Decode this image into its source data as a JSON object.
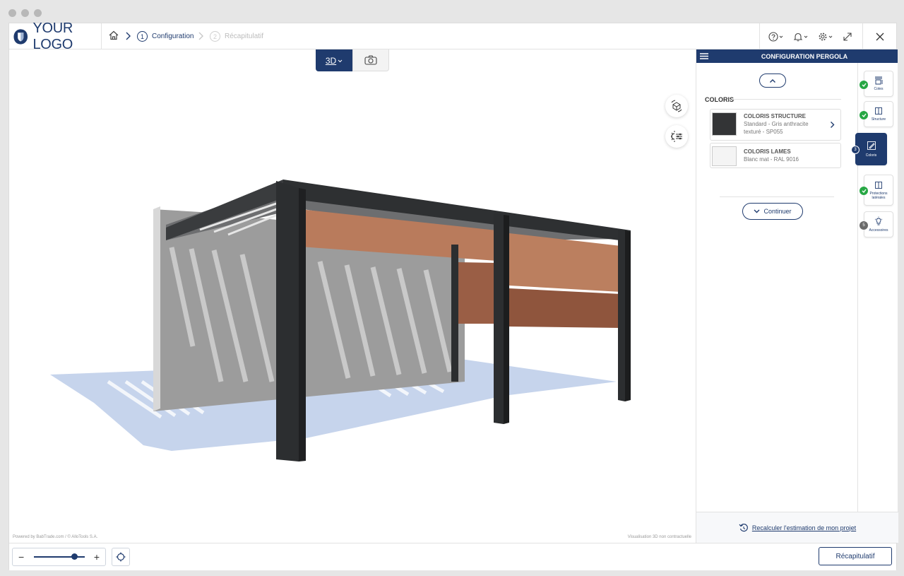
{
  "window": {
    "controls": [
      "dot",
      "dot",
      "dot"
    ]
  },
  "header": {
    "logo_text": "YOUR LOGO",
    "breadcrumb": [
      {
        "num": "1",
        "label": "Configuration",
        "state": "active"
      },
      {
        "num": "2",
        "label": "Récapitulatif",
        "state": "inactive"
      }
    ],
    "icons": [
      "help-icon",
      "bell-icon",
      "gear-icon",
      "expand-icon"
    ],
    "close_icon": "close-icon"
  },
  "viewer": {
    "tabs": {
      "view3d_label": "3D",
      "photo_icon": "camera-icon"
    },
    "tools": [
      "rotate-cube-icon",
      "light-settings-icon"
    ],
    "powered_by": "Powered by BabTrade.com / © AlloTools S.A.",
    "disclaimer": "Visualisation 3D non contractuelle"
  },
  "bottom_bar": {
    "zoom_minus": "−",
    "zoom_plus": "+",
    "zoom_level": 0.8,
    "recap_label": "Récapitulatif"
  },
  "panel": {
    "title": "CONFIGURATION PERGOLA",
    "section_title": "COLORIS",
    "options": [
      {
        "title": "COLORIS STRUCTURE",
        "line1": "Standard - Gris anthracite",
        "line2": "texturé - SP055",
        "swatch": "#333436",
        "has_arrow": true
      },
      {
        "title": "COLORIS LAMES",
        "line1": "Blanc mat - RAL 9016",
        "line2": "",
        "swatch": "#f4f4f4",
        "has_arrow": false
      }
    ],
    "continue_label": "Continuer",
    "recalc_label": "Recalculer l'estimation de mon projet",
    "steps": [
      {
        "label": "Cotes",
        "badge": "ok"
      },
      {
        "label": "Structure",
        "badge": "ok"
      },
      {
        "label": "Coloris",
        "badge": "3"
      },
      {
        "label": "Protections latérales",
        "badge": "ok"
      },
      {
        "label": "Accessoires",
        "badge": "5"
      }
    ]
  },
  "colors": {
    "brand": "#1f3b6e",
    "success": "#27a744",
    "frame": "#323436",
    "store": "#b47457"
  }
}
